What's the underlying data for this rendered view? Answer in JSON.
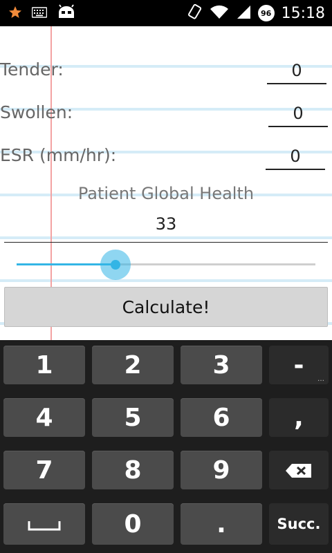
{
  "status_bar": {
    "time": "15:18",
    "battery_level": "96",
    "icons_left": [
      "star-icon",
      "keyboard-icon",
      "android-icon"
    ],
    "icons_right": [
      "rotate-icon",
      "wifi-icon",
      "signal-icon",
      "battery-badge"
    ]
  },
  "form": {
    "tender": {
      "label": "Tender:",
      "value": "0"
    },
    "swollen": {
      "label": "Swollen:",
      "value": "0"
    },
    "esr": {
      "label": "ESR (mm/hr):",
      "value": "0"
    }
  },
  "global_health": {
    "title": "Patient Global Health",
    "value": "33",
    "slider_fraction": 0.33,
    "accent_color": "#33b5e5"
  },
  "calculate_button": {
    "label": "Calculate!"
  },
  "keyboard": {
    "rows": [
      [
        "1",
        "2",
        "3",
        "-"
      ],
      [
        "4",
        "5",
        "6",
        ","
      ],
      [
        "7",
        "8",
        "9",
        "backspace"
      ],
      [
        "space",
        "0",
        ".",
        "Succ."
      ]
    ],
    "dash_key": "-",
    "comma_key": ",",
    "dot_key": ".",
    "enter_key": "Succ."
  }
}
